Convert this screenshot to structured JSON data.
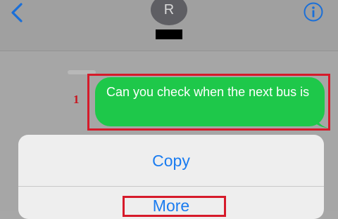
{
  "header": {
    "avatar_initial": "R",
    "back_icon": "chevron-left-icon",
    "info_icon": "info-icon"
  },
  "conversation": {
    "message_text": "Can you check when the next bus is",
    "bubble_color": "#1ec84a"
  },
  "annotation": {
    "step_number": "1",
    "highlight_color": "#d61a2a"
  },
  "action_sheet": {
    "copy_label": "Copy",
    "more_label": "More",
    "accent_color": "#1a7cf0"
  }
}
